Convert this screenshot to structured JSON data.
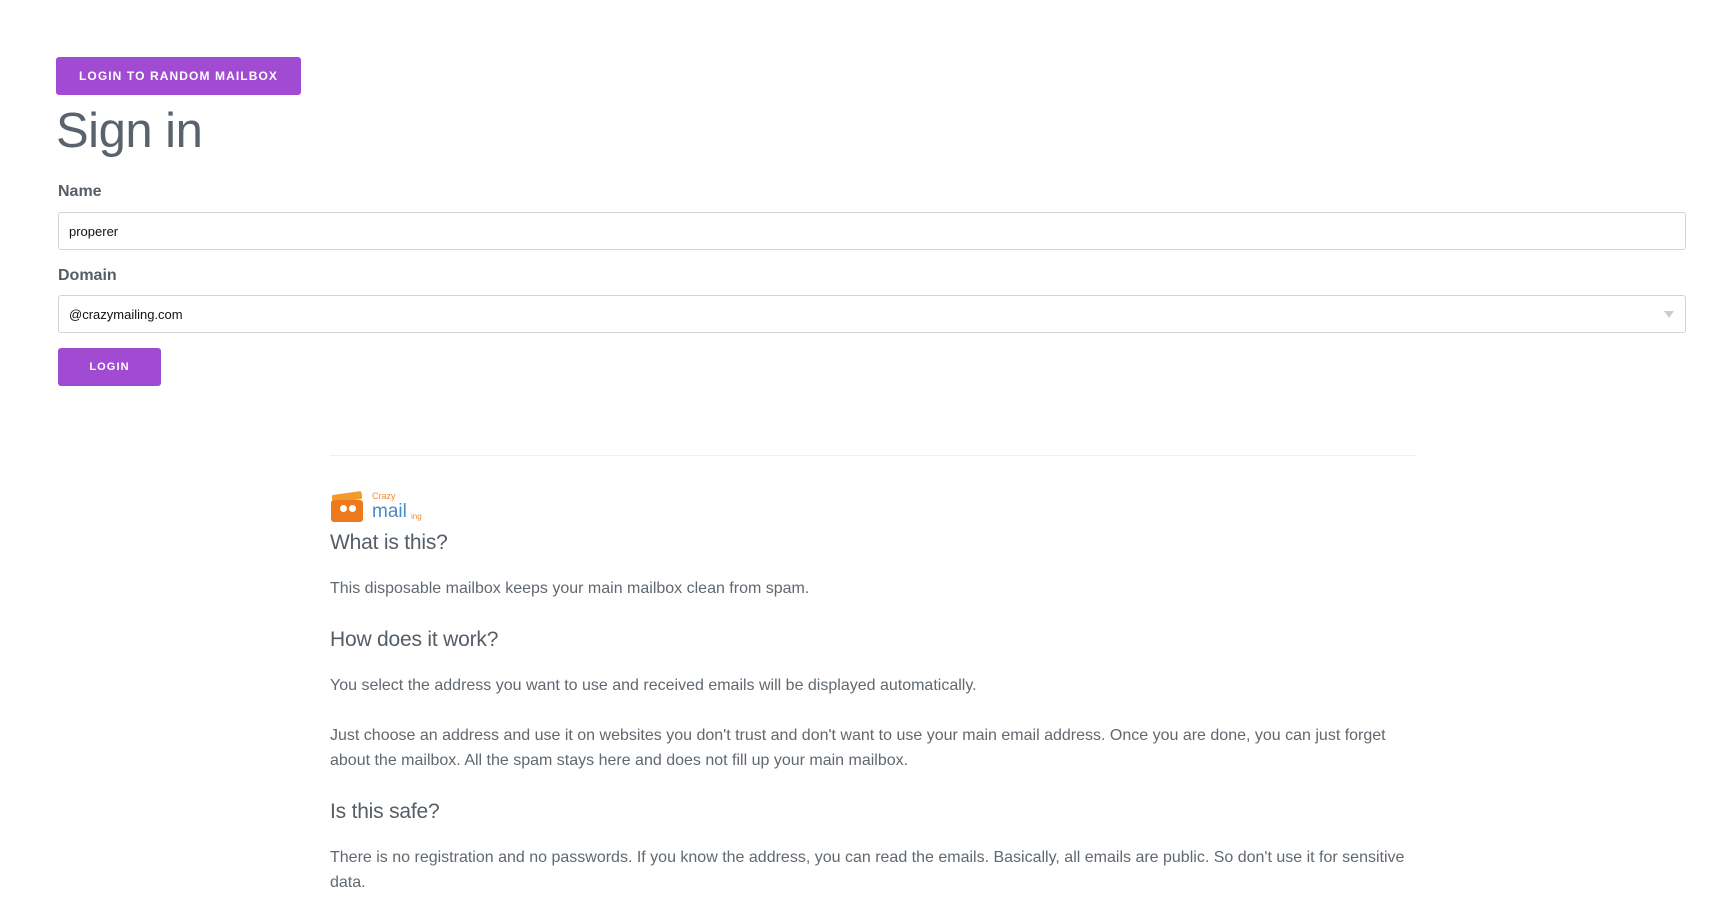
{
  "random_button_label": "LOGIN TO RANDOM MAILBOX",
  "title": "Sign in",
  "form": {
    "name_label": "Name",
    "name_value": "properer",
    "domain_label": "Domain",
    "domain_value": "@crazymailing.com",
    "login_label": "LOGIN"
  },
  "logo": {
    "crazy": "Crazy",
    "mail": "mail",
    "ing": "ing"
  },
  "info": {
    "what_heading": "What is this?",
    "what_text": "This disposable mailbox keeps your main mailbox clean from spam.",
    "how_heading": "How does it work?",
    "how_text_1": "You select the address you want to use and received emails will be displayed automatically.",
    "how_text_2": "Just choose an address and use it on websites you don't trust and don't want to use your main email address. Once you are done, you can just forget about the mailbox. All the spam stays here and does not fill up your main mailbox.",
    "safe_heading": "Is this safe?",
    "safe_text": "There is no registration and no passwords. If you know the address, you can read the emails. Basically, all emails are public. So don't use it for sensitive data."
  },
  "colors": {
    "accent": "#a14ad2",
    "text": "#555d66",
    "logo_orange": "#ee7a1d",
    "logo_blue": "#4a8bc4"
  }
}
